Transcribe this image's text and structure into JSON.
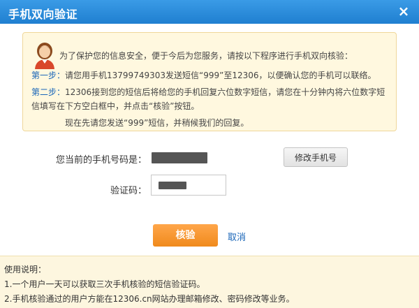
{
  "dialog": {
    "title": "手机双向验证",
    "close_glyph": "×",
    "avatar_icon": "user-avatar-icon"
  },
  "notice": {
    "intro": "为了保护您的信息安全，便于今后为您服务，请按以下程序进行手机双向核验：",
    "step1_label": "第一步：",
    "step1_text": "请您用手机13799749303发送短信“999”至12306，以便确认您的手机可以联络。",
    "step2_label": "第二步：",
    "step2_text_line1": "12306接到您的短信后将给您的手机回复六位数字短信，请您在十分钟内将六位数字短",
    "step2_text_line2": "信填写在下方空白框中，并点击“核验”按钮。",
    "step3_text": "现在先请您发送“999”短信，并稍候我们的回复。"
  },
  "form": {
    "phone_label": "您当前的手机号码是：",
    "code_label": "验证码：",
    "change_phone_button": "修改手机号",
    "verify_button": "核验",
    "cancel_link": "取消"
  },
  "usage": {
    "title": "使用说明：",
    "item1": "1.一个用户一天可以获取三次手机核验的短信验证码。",
    "item2": "2.手机核验通过的用户方能在12306.cn网站办理邮箱修改、密码修改等业务。"
  },
  "colors": {
    "titlebar": "#1f7fd0",
    "notice_bg": "#fff8df",
    "verify_button": "#f08a1c",
    "link": "#1a66b8"
  }
}
